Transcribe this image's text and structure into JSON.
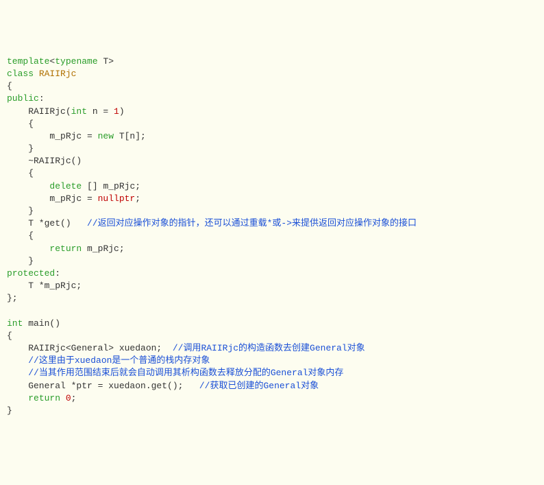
{
  "code": {
    "l1": {
      "a": "template",
      "b": "<",
      "c": "typename",
      "d": " T>"
    },
    "l2": {
      "a": "class",
      "b": " RAIIRjc"
    },
    "l3": "{",
    "l4": {
      "a": "public",
      "b": ":"
    },
    "l5": {
      "a": "    RAIIRjc(",
      "b": "int",
      "c": " n = ",
      "d": "1",
      "e": ")"
    },
    "l6": "    {",
    "l7": {
      "a": "        m_pRjc = ",
      "b": "new",
      "c": " T[n];"
    },
    "l8": "    }",
    "l9": "    ~RAIIRjc()",
    "l10": "    {",
    "l11": {
      "a": "        ",
      "b": "delete",
      "c": " [] m_pRjc;"
    },
    "l12": {
      "a": "        m_pRjc = ",
      "b": "nullptr",
      "c": ";"
    },
    "l13": "    }",
    "l14": {
      "a": "    T *get()   ",
      "b": "//返回对应操作对象的指针，还可以通过重载*或->来提供返回对应操作对象的接口"
    },
    "l15": "    {",
    "l16": {
      "a": "        ",
      "b": "return",
      "c": " m_pRjc;"
    },
    "l17": "    }",
    "l18": {
      "a": "protected",
      "b": ":"
    },
    "l19": "    T *m_pRjc;",
    "l20": "};",
    "l21": "",
    "l22": {
      "a": "int",
      "b": " main()"
    },
    "l23": "{",
    "l24": {
      "a": "    RAIIRjc<General> xuedaon;  ",
      "b": "//调用RAIIRjc的构造函数去创建General对象"
    },
    "l25": {
      "a": "    ",
      "b": "//这里由于xuedaon是一个普通的栈内存对象"
    },
    "l26": {
      "a": "    ",
      "b": "//当其作用范围结束后就会自动调用其析构函数去释放分配的General对象内存"
    },
    "l27": {
      "a": "    General *ptr = xuedaon.get();   ",
      "b": "//获取已创建的General对象"
    },
    "l28": {
      "a": "    ",
      "b": "return",
      "c": " ",
      "d": "0",
      "e": ";"
    },
    "l29": "}"
  }
}
